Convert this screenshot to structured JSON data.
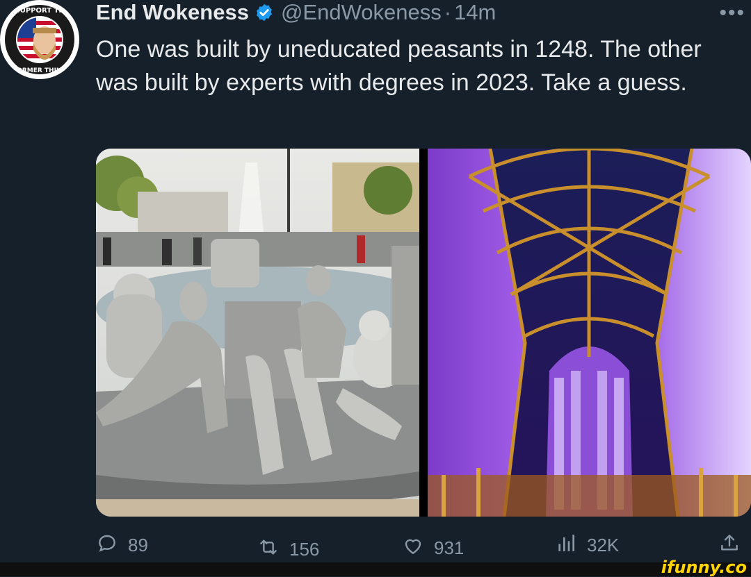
{
  "author": {
    "display_name": "End Wokeness",
    "handle": "@EndWokeness",
    "separator": "·",
    "time": "14m",
    "verified_icon": "verified-badge-icon",
    "avatar_text_top": "I SUPPORT THE",
    "avatar_text_bottom": "FORMER THING"
  },
  "more_icon": "more-icon",
  "tweet": {
    "text": "One was built by uneducated peasants in 1248. The other was built by experts with degrees in 2023. Take a guess."
  },
  "media": {
    "left_image": "modern-concrete-sculpture-fountain-photo",
    "right_image": "gothic-chapel-stained-glass-interior-photo"
  },
  "actions": {
    "reply": {
      "icon": "reply-icon",
      "count": "89"
    },
    "retweet": {
      "icon": "retweet-icon",
      "count": "156"
    },
    "like": {
      "icon": "heart-icon",
      "count": "931"
    },
    "views": {
      "icon": "views-icon",
      "count": "32K"
    },
    "share": {
      "icon": "share-icon"
    }
  },
  "watermark": "ifunny.co",
  "colors": {
    "background": "#15202b",
    "text": "#e7e9ea",
    "muted": "#8b98a5",
    "verified": "#1d9bf0",
    "watermark": "#ffd400"
  }
}
